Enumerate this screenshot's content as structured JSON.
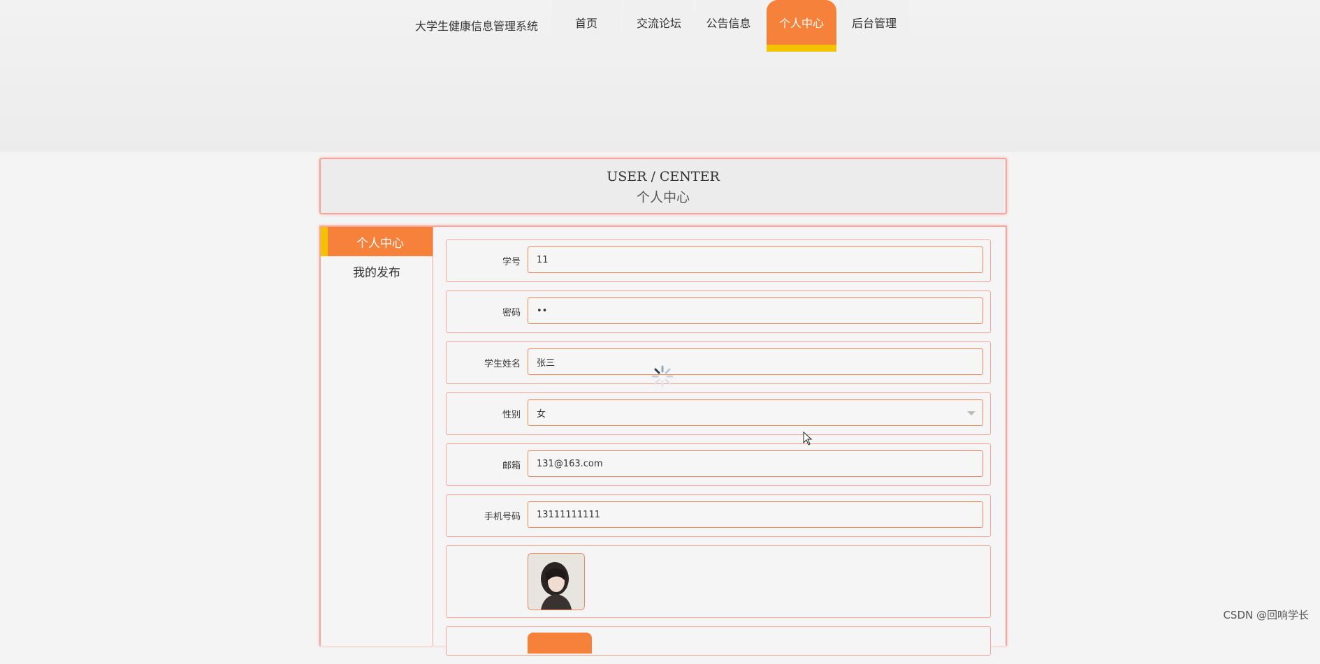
{
  "header": {
    "site_title": "大学生健康信息管理系统",
    "nav": [
      {
        "label": "首页"
      },
      {
        "label": "交流论坛"
      },
      {
        "label": "公告信息"
      },
      {
        "label": "个人中心",
        "active": true
      },
      {
        "label": "后台管理"
      }
    ]
  },
  "title_box": {
    "en": "USER / CENTER",
    "cn": "个人中心"
  },
  "sidebar": {
    "items": [
      {
        "label": "个人中心",
        "active": true
      },
      {
        "label": "我的发布"
      }
    ]
  },
  "form": {
    "student_id": {
      "label": "学号",
      "value": "11"
    },
    "password": {
      "label": "密码",
      "value": "••"
    },
    "name": {
      "label": "学生姓名",
      "value": "张三"
    },
    "gender": {
      "label": "性别",
      "value": "女"
    },
    "email": {
      "label": "邮箱",
      "value": "131@163.com"
    },
    "phone": {
      "label": "手机号码",
      "value": "13111111111"
    }
  },
  "watermark": "CSDN @回响学长",
  "colors": {
    "accent": "#f5813a",
    "highlight": "#f5c200",
    "border": "#f7a49c"
  }
}
